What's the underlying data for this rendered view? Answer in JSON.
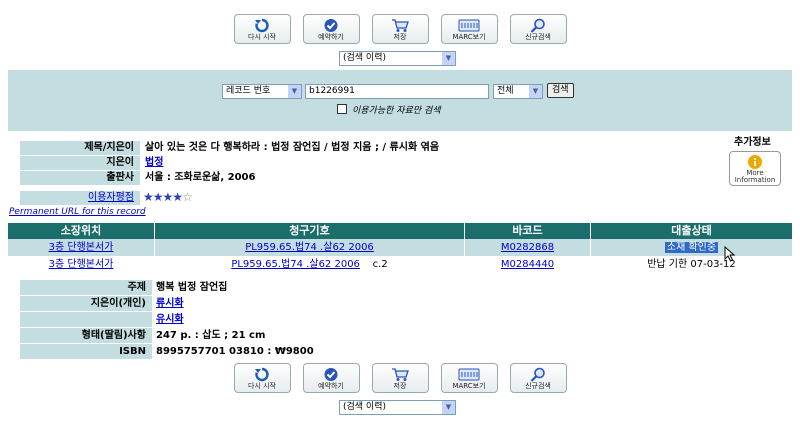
{
  "toolbar": {
    "buttons": [
      {
        "label": "다시 시작",
        "icon": "refresh-icon"
      },
      {
        "label": "예약하기",
        "icon": "check-icon"
      },
      {
        "label": "저장",
        "icon": "cart-icon"
      },
      {
        "label": "MARC보기",
        "icon": "keyboard-icon"
      },
      {
        "label": "신규검색",
        "icon": "magnifier-icon"
      }
    ]
  },
  "history_select": {
    "value": "(검색 이력)"
  },
  "search": {
    "field_select": "레코드 번호",
    "query": "b1226991",
    "scope_select": "전체",
    "submit_label": "검색",
    "available_only_label": "이용가능한 자료만 검색"
  },
  "record": {
    "title_label": "제목/지은이",
    "title_value": "살아 있는 것은 다 행복하라 : 법정 잠언집 / 법정 지음 ; / 류시화 엮음",
    "author_label": "지은이",
    "author_value": "법정",
    "publisher_label": "출판사",
    "publisher_value": "서울 : 조화로운삶, 2006",
    "rating_label": "이용자평점",
    "rating_stars": 4,
    "rating_max": 5,
    "permanent_url": "Permanent URL for this record",
    "extra_info_label": "추가정보",
    "more_info_line1": "More",
    "more_info_line2": "Information"
  },
  "holdings": {
    "headers": [
      "소장위치",
      "청구기호",
      "바코드",
      "대출상태"
    ],
    "rows": [
      {
        "location": "3층 단행본서가",
        "call_number": "PL959.65.법74 .살62 2006",
        "copy": "",
        "barcode": "M0282868",
        "status": "소재 확인중"
      },
      {
        "location": "3층 단행본서가",
        "call_number": "PL959.65.법74 .살62 2006",
        "copy": "c.2",
        "barcode": "M0284440",
        "status": "반납 기한 07-03-12"
      }
    ]
  },
  "details": {
    "subject_label": "주제",
    "subject_value": "행복 법정 잠언집",
    "person_label": "지은이(개인)",
    "person_values": [
      "류시화",
      "유시화"
    ],
    "format_label": "형태(딸림)사항",
    "format_value": "247 p. : 삽도 ; 21 cm",
    "isbn_label": "ISBN",
    "isbn_value": "8995757701 03810 : ₩9800"
  },
  "colors": {
    "band": "#c3dde0",
    "header": "#1c6e6c",
    "link": "#0000cc",
    "selected": "#316ac5"
  }
}
